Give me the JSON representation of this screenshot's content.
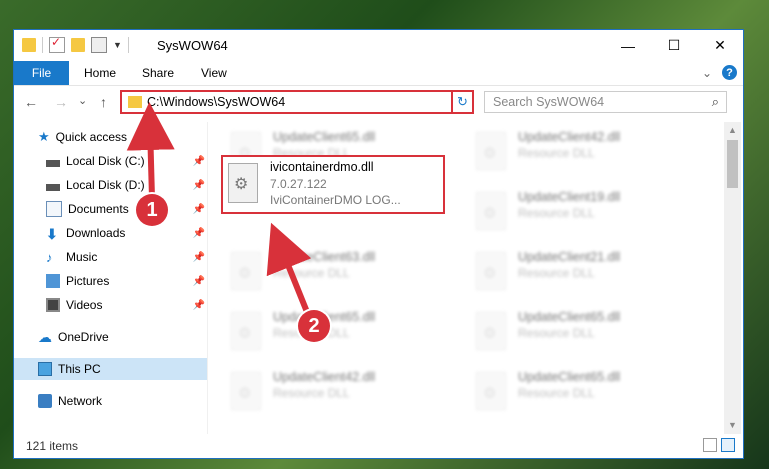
{
  "window": {
    "title": "SysWOW64",
    "controls": {
      "minimize": "—",
      "maximize": "☐",
      "close": "✕"
    }
  },
  "ribbon": {
    "file_tab": "File",
    "tabs": [
      "Home",
      "Share",
      "View"
    ]
  },
  "nav": {
    "back": "←",
    "forward": "→",
    "recent": "⌄",
    "up": "↑",
    "address": "C:\\Windows\\SysWOW64",
    "address_dropdown": "⌄",
    "refresh": "↻",
    "search_placeholder": "Search SysWOW64",
    "search_icon": "⌕"
  },
  "sidebar": {
    "items": [
      {
        "label": "Quick access",
        "icon": "star-icon"
      },
      {
        "label": "Local Disk (C:)",
        "icon": "disk-icon",
        "pinned": true
      },
      {
        "label": "Local Disk (D:)",
        "icon": "disk-icon",
        "pinned": true
      },
      {
        "label": "Documents",
        "icon": "documents-icon",
        "pinned": true
      },
      {
        "label": "Downloads",
        "icon": "downloads-icon",
        "pinned": true
      },
      {
        "label": "Music",
        "icon": "music-icon",
        "pinned": true
      },
      {
        "label": "Pictures",
        "icon": "pictures-icon",
        "pinned": true
      },
      {
        "label": "Videos",
        "icon": "videos-icon",
        "pinned": true
      },
      {
        "label": "OneDrive",
        "icon": "onedrive-icon"
      },
      {
        "label": "This PC",
        "icon": "this-pc-icon",
        "selected": true
      },
      {
        "label": "Network",
        "icon": "network-icon"
      }
    ]
  },
  "files": {
    "left": [
      {
        "name": "UpdateClient65.dll",
        "type": "Resource DLL"
      },
      {
        "name": "UpdateClient63.dll",
        "type": "Resource DLL"
      },
      {
        "name": "UpdateClient65.dll",
        "type": "Resource DLL"
      },
      {
        "name": "UpdateClient42.dll",
        "type": "Resource DLL"
      }
    ],
    "right": [
      {
        "name": "UpdateClient42.dll",
        "type": "Resource DLL"
      },
      {
        "name": "UpdateClient19.dll",
        "type": "Resource DLL"
      },
      {
        "name": "UpdateClient21.dll",
        "type": "Resource DLL"
      },
      {
        "name": "UpdateClient65.dll",
        "type": "Resource DLL"
      },
      {
        "name": "UpdateClient65.dll",
        "type": "Resource DLL"
      }
    ],
    "highlighted": {
      "name": "ivicontainerdmo.dll",
      "version": "7.0.27.122",
      "description": "IviContainerDMO LOG..."
    }
  },
  "status": {
    "item_count": "121 items"
  },
  "annotations": {
    "step1": "1",
    "step2": "2",
    "color": "#d8313a"
  }
}
